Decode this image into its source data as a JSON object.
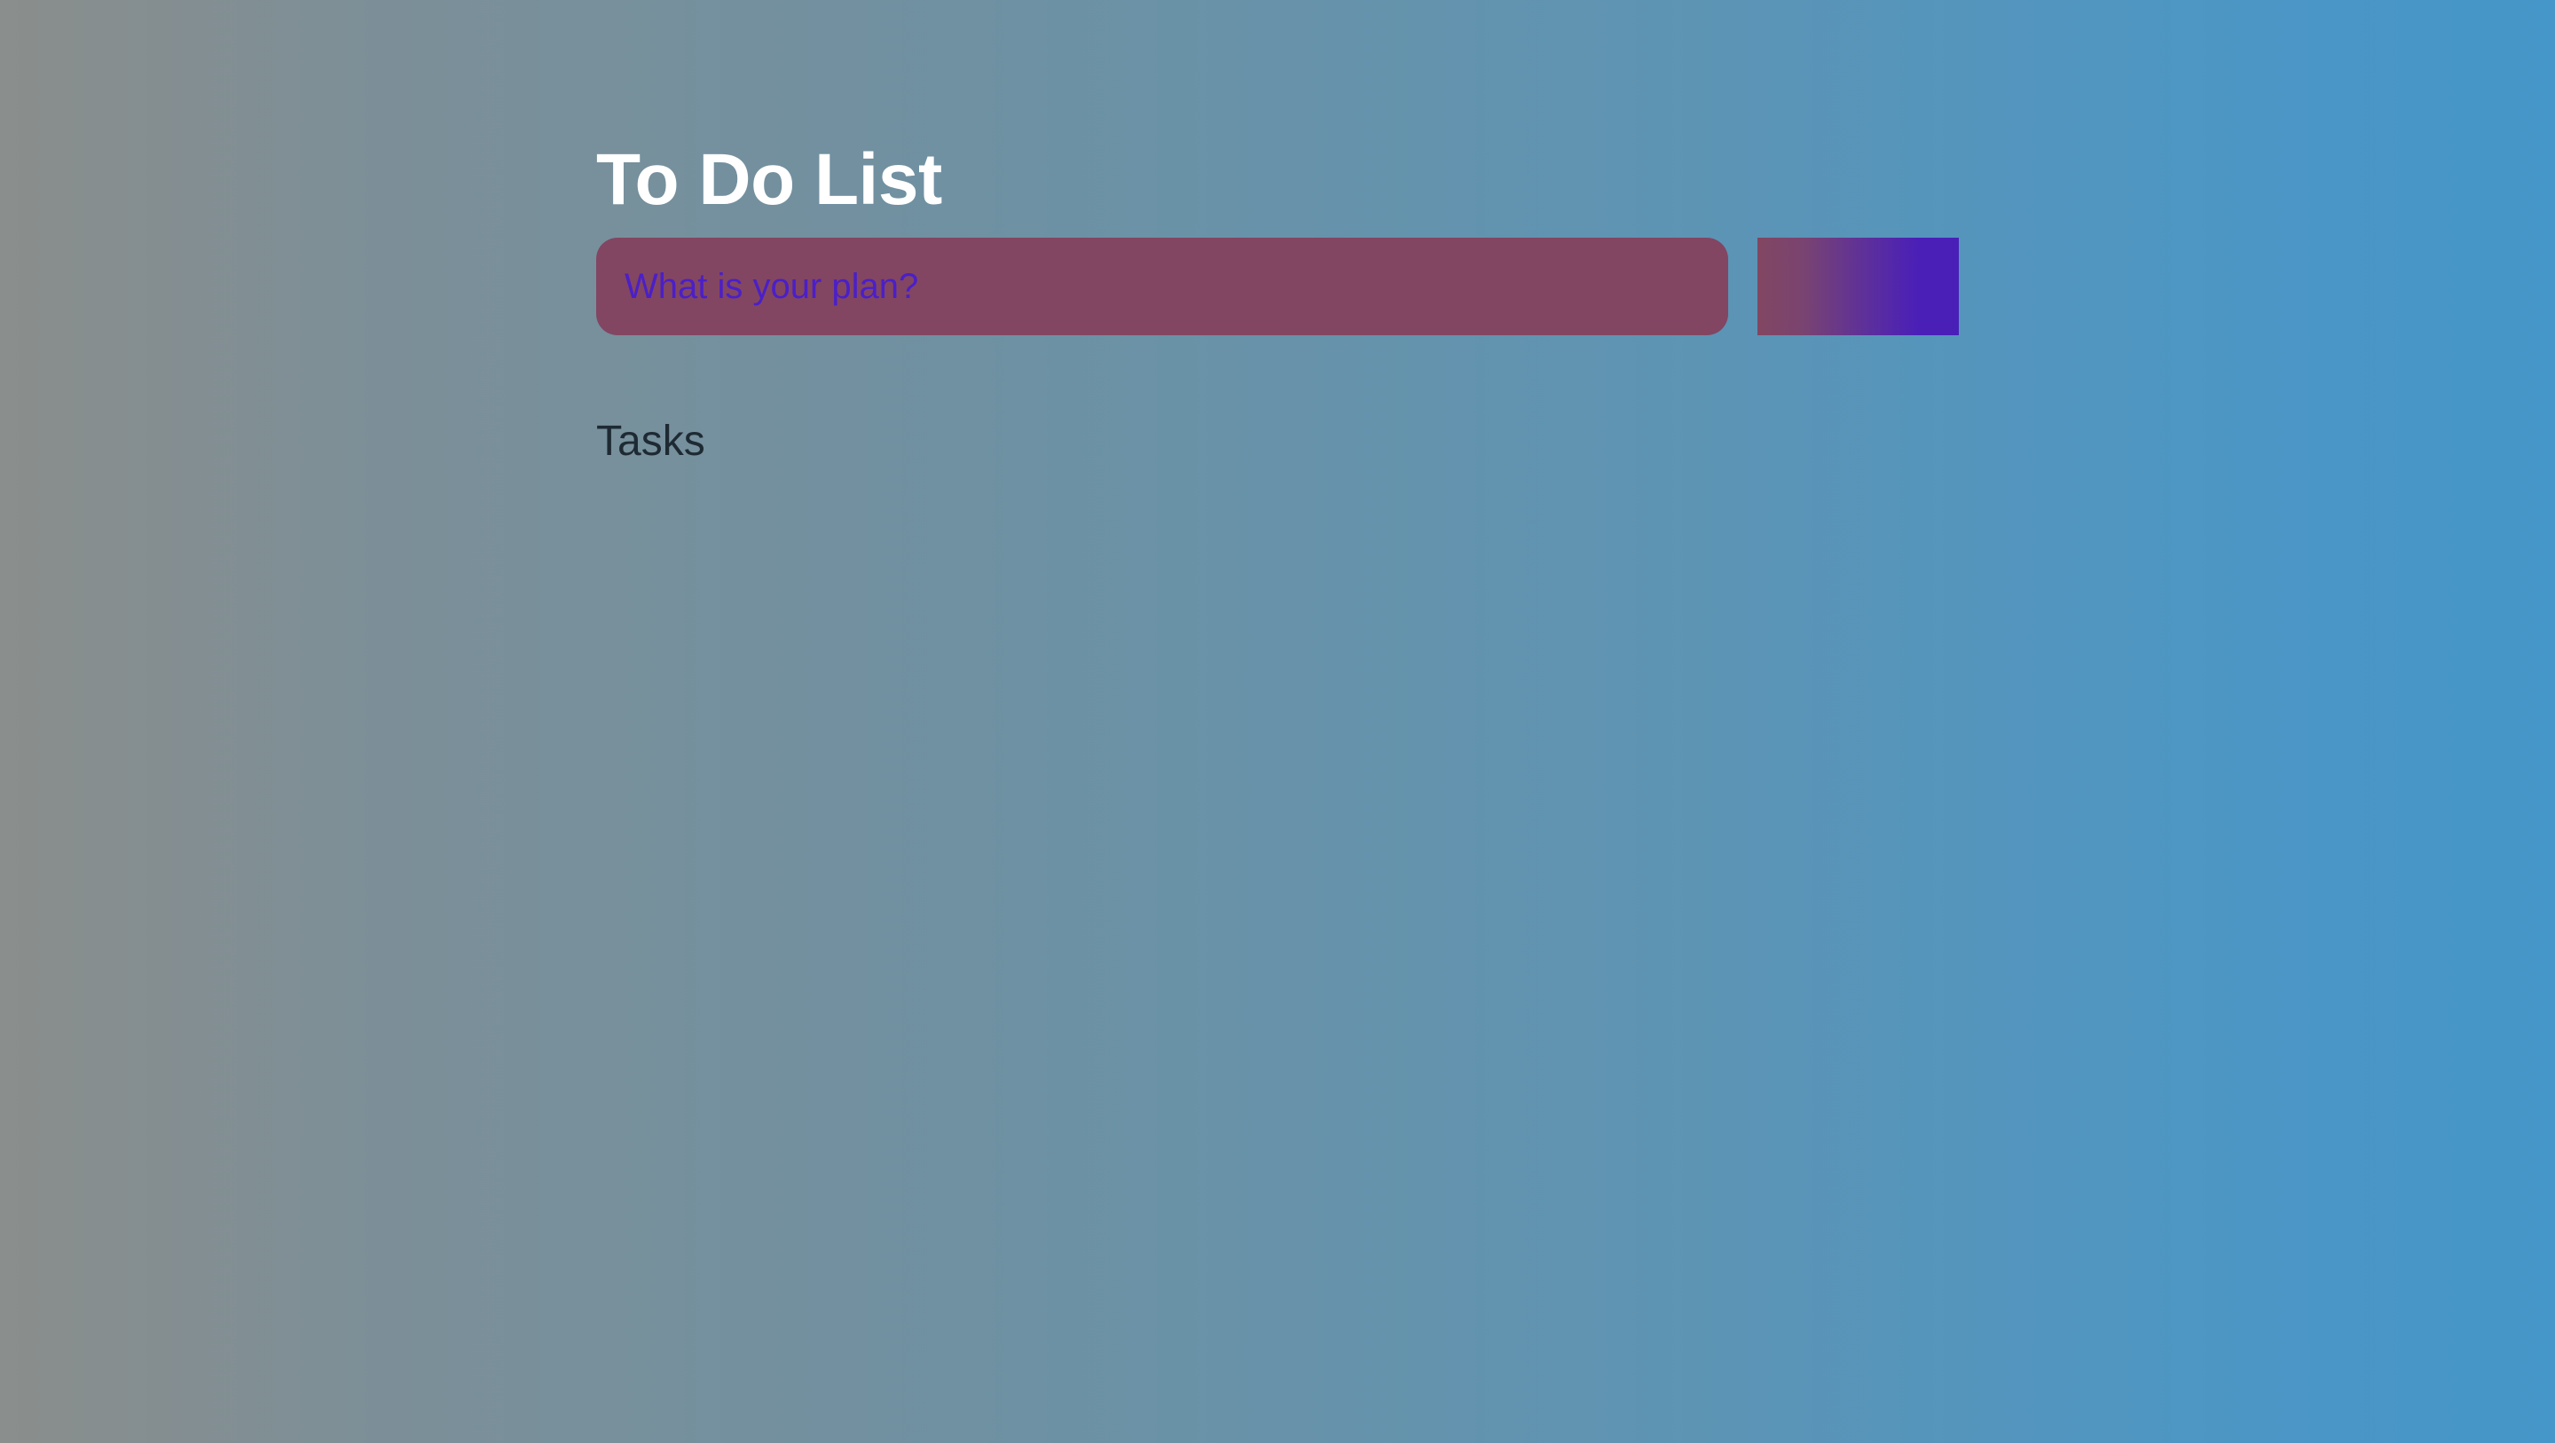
{
  "app": {
    "title": "To Do List"
  },
  "form": {
    "input_placeholder": "What is your plan?",
    "input_value": "",
    "add_button_label": ""
  },
  "tasks": {
    "heading": "Tasks",
    "items": []
  },
  "colors": {
    "background_left": "#8a8e8c",
    "background_right": "#4596c9",
    "input_background": "#824662",
    "input_text": "#4b1fc8",
    "button_gradient_end": "#4a1fb8",
    "title_text": "#ffffff",
    "heading_text": "#1e2a33"
  }
}
